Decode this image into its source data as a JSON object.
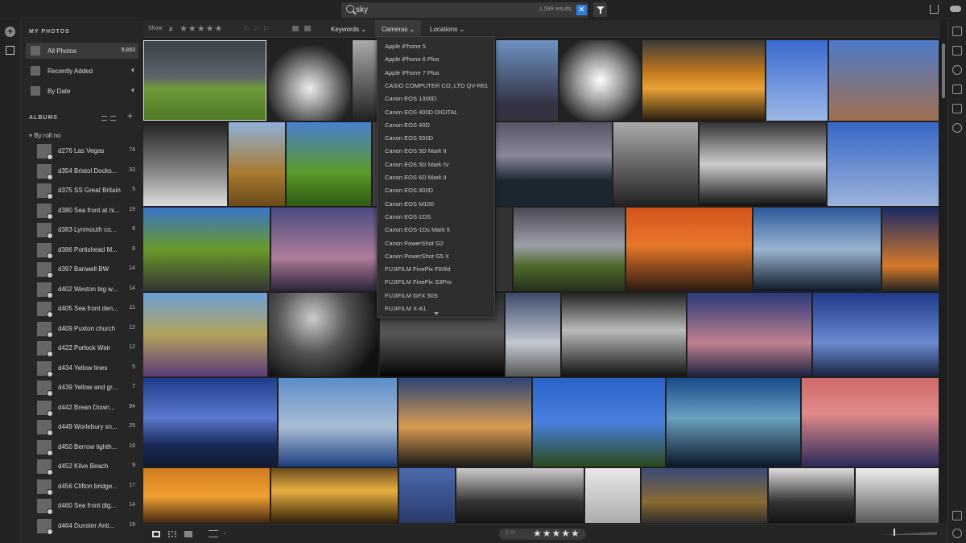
{
  "search": {
    "query": "sky",
    "result_count": "1,599 results",
    "clear_label": "✕"
  },
  "sidebar": {
    "my_photos_header": "MY PHOTOS",
    "nav": [
      {
        "label": "All Photos",
        "count": "9,883",
        "active": true
      },
      {
        "label": "Recently Added",
        "count": "",
        "active": false
      },
      {
        "label": "By Date",
        "count": "",
        "active": false
      }
    ],
    "albums_header": "ALBUMS",
    "by_roll_label": "By roll no",
    "albums": [
      {
        "label": "d276 Las Vegas",
        "count": "74"
      },
      {
        "label": "d354 Bristol Docks...",
        "count": "33"
      },
      {
        "label": "d375 SS Great Britain",
        "count": "5"
      },
      {
        "label": "d380 Sea front at ni...",
        "count": "19"
      },
      {
        "label": "d383 Lynmouth co...",
        "count": "8"
      },
      {
        "label": "d386 Portishead M...",
        "count": "8"
      },
      {
        "label": "d397 Banwell BW",
        "count": "14"
      },
      {
        "label": "d402 Weston big w...",
        "count": "14"
      },
      {
        "label": "d405 Sea front den...",
        "count": "11"
      },
      {
        "label": "d409 Puxton church",
        "count": "12"
      },
      {
        "label": "d422 Porlock Weir",
        "count": "12"
      },
      {
        "label": "d434 Yellow lines",
        "count": "5"
      },
      {
        "label": "d439 Yellow and gr...",
        "count": "7"
      },
      {
        "label": "d442 Brean Down...",
        "count": "94"
      },
      {
        "label": "d449 Worlebury sn...",
        "count": "25"
      },
      {
        "label": "d450 Berrow lighth...",
        "count": "16"
      },
      {
        "label": "d452 Kilve Beach",
        "count": "9"
      },
      {
        "label": "d456 Clifton bridge...",
        "count": "17"
      },
      {
        "label": "d460 Sea front dig...",
        "count": "14"
      },
      {
        "label": "d464 Dunster Anti...",
        "count": "19"
      }
    ]
  },
  "toolbar": {
    "show_label": "Show",
    "ge_label": "≥",
    "stars": "★★★★★",
    "flags": "⚐⚐⚐",
    "menus": [
      "Keywords",
      "Cameras",
      "Locations"
    ]
  },
  "cameras_dropdown": [
    "Apple iPhone 5",
    "Apple iPhone 6 Plus",
    "Apple iPhone 7 Plus",
    "CASIO COMPUTER CO.,LTD QV-R61",
    "Canon EOS 1300D",
    "Canon EOS 400D DIGITAL",
    "Canon EOS 40D",
    "Canon EOS 550D",
    "Canon EOS 5D Mark II",
    "Canon EOS 5D Mark IV",
    "Canon EOS 6D Mark II",
    "Canon EOS 800D",
    "Canon EOS M100",
    "Canon EOS-1DS",
    "Canon EOS-1Ds Mark II",
    "Canon PowerShot G2",
    "Canon PowerShot G5 X",
    "FUJIFILM FinePix F60fd",
    "FUJIFILM FinePix S3Pro",
    "FUJIFILM GFX 50S",
    "FUJIFILM X-A1"
  ],
  "bottom": {
    "flags": "⚐⚐",
    "stars": "★★★★★",
    "rating": 4
  },
  "colors": {
    "accent": "#2d7fe0",
    "background": "#1e1e1e",
    "panel": "#262626"
  }
}
